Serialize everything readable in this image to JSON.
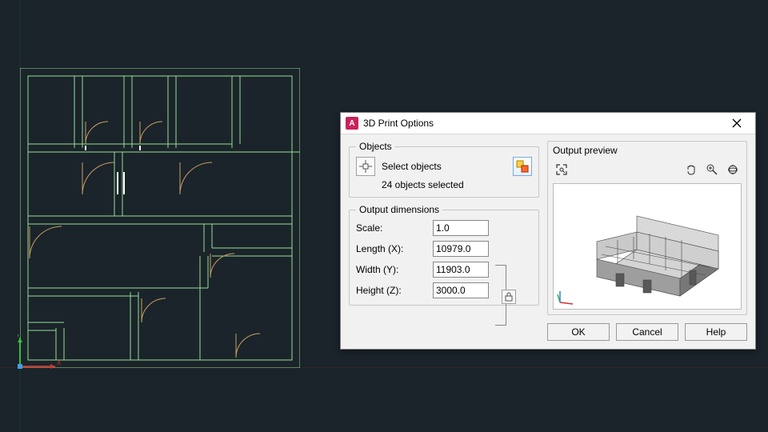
{
  "dialog": {
    "title": "3D Print Options",
    "objects": {
      "section_label": "Objects",
      "select_label": "Select objects",
      "count_text": "24 objects selected"
    },
    "dimensions": {
      "section_label": "Output dimensions",
      "scale_label": "Scale:",
      "length_label": "Length (X):",
      "width_label": "Width (Y):",
      "height_label": "Height (Z):",
      "scale": "1.0",
      "length": "10979.0",
      "width": "11903.0",
      "height": "3000.0"
    },
    "preview": {
      "section_label": "Output preview"
    },
    "buttons": {
      "ok": "OK",
      "cancel": "Cancel",
      "help": "Help"
    }
  },
  "icons": {
    "app_letter": "A"
  }
}
